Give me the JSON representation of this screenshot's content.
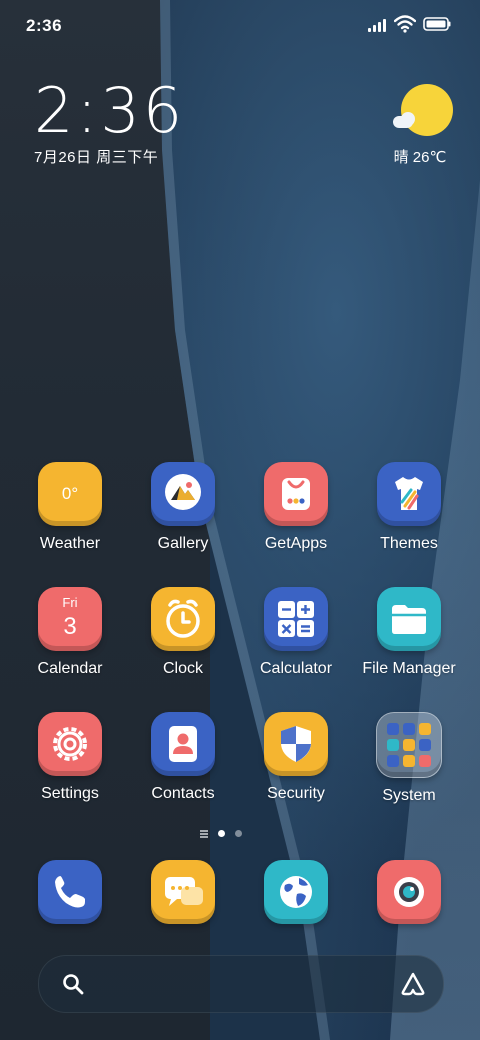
{
  "status_bar": {
    "time": "2:36",
    "icons": [
      "signal-icon",
      "wifi-icon",
      "battery-icon"
    ]
  },
  "clock_widget": {
    "time": "2:36",
    "date": "7月26日 周三下午"
  },
  "weather_widget": {
    "icon": "sunny-cloud-icon",
    "text": "晴 26℃"
  },
  "apps": [
    {
      "label": "Weather",
      "icon": "weather-icon",
      "color": "#f5b530",
      "tile_text": "0°"
    },
    {
      "label": "Gallery",
      "icon": "gallery-icon",
      "color": "#3b63c4"
    },
    {
      "label": "GetApps",
      "icon": "getapps-icon",
      "color": "#ef6b6b"
    },
    {
      "label": "Themes",
      "icon": "themes-icon",
      "color": "#3b63c4"
    },
    {
      "label": "Calendar",
      "icon": "calendar-icon",
      "color": "#ef6b6b",
      "tile_day": "Fri",
      "tile_num": "3"
    },
    {
      "label": "Clock",
      "icon": "alarm-clock-icon",
      "color": "#f5b530"
    },
    {
      "label": "Calculator",
      "icon": "calculator-icon",
      "color": "#3b63c4"
    },
    {
      "label": "File Manager",
      "icon": "folder-icon",
      "color": "#2fb8c8"
    },
    {
      "label": "Settings",
      "icon": "gear-icon",
      "color": "#ef6b6b"
    },
    {
      "label": "Contacts",
      "icon": "contacts-icon",
      "color": "#3b63c4"
    },
    {
      "label": "Security",
      "icon": "shield-icon",
      "color": "#f5b530"
    },
    {
      "label": "System",
      "icon": "folder-icon",
      "color": "#ffffff"
    }
  ],
  "page_indicator": {
    "pages": 2,
    "current": 1
  },
  "dock": [
    {
      "icon": "phone-icon",
      "color": "#3b63c4"
    },
    {
      "icon": "messages-icon",
      "color": "#f5b530"
    },
    {
      "icon": "browser-icon",
      "color": "#2fb8c8"
    },
    {
      "icon": "camera-icon",
      "color": "#ef6b6b"
    }
  ],
  "search_bar": {
    "icons": [
      "search-icon",
      "assistant-icon"
    ]
  }
}
